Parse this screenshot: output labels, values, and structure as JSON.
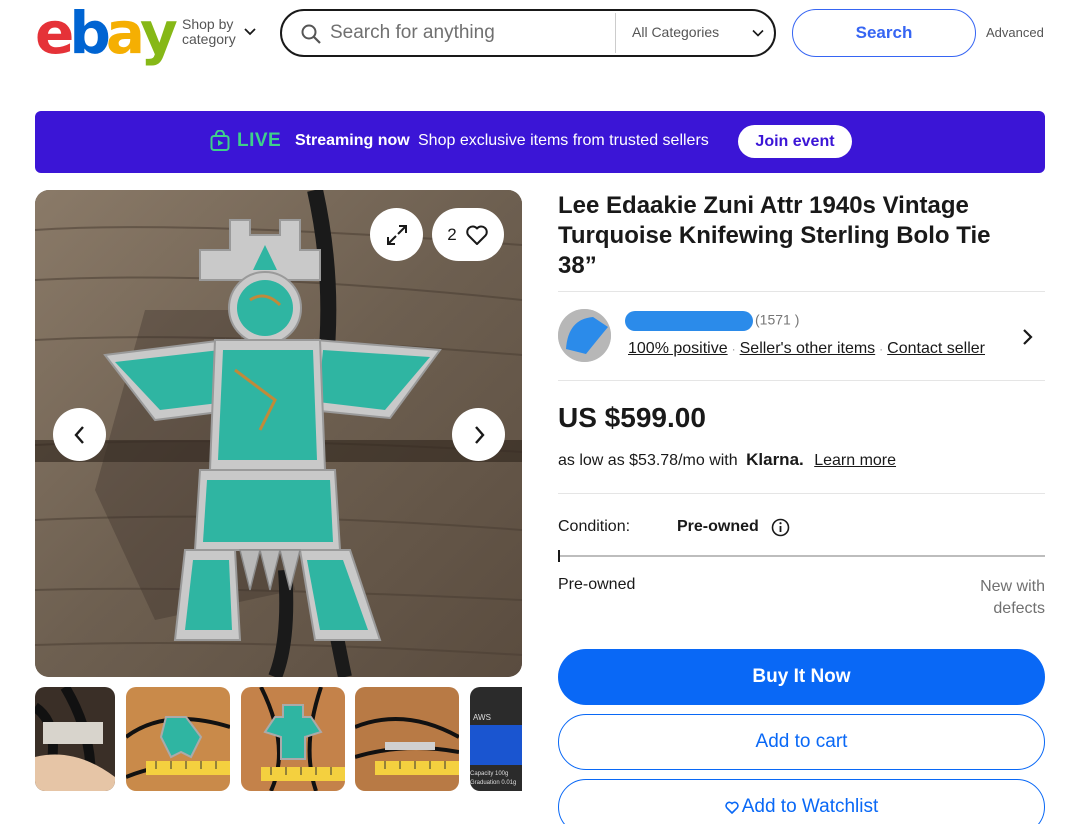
{
  "header": {
    "logo_letters": [
      "e",
      "b",
      "a",
      "y"
    ],
    "logo_colors": [
      "#e53238",
      "#0064d2",
      "#f5af02",
      "#86b817"
    ],
    "shop_by_line1": "Shop by",
    "shop_by_line2": "category",
    "search_placeholder": "Search for anything",
    "category_select": "All Categories",
    "search_button": "Search",
    "advanced_link": "Advanced"
  },
  "live_banner": {
    "live_label": "LIVE",
    "streaming_label": "Streaming now",
    "message": "Shop exclusive items from trusted sellers",
    "join_button": "Join event",
    "background": "#3b15d6",
    "live_color": "#3ed08a"
  },
  "gallery": {
    "watch_count": "2",
    "icons": [
      "expand-icon",
      "heart-icon",
      "chevron-left-icon",
      "chevron-right-icon"
    ],
    "thumb_scale_text": "AWS",
    "thumb_scale_caption1": "Capacity 100g",
    "thumb_scale_caption2": "Graduation 0.01g"
  },
  "listing": {
    "title": "Lee Edaakie Zuni Attr 1940s Vintage Turquoise Knifewing Sterling Bolo Tie 38”",
    "seller": {
      "feedback_count": "(1571 )",
      "positive": "100% positive",
      "other_items": "Seller's other items",
      "contact": "Contact seller"
    },
    "price": "US $599.00",
    "klarna": {
      "prefix": "as low as $53.78/mo with",
      "brand": "Klarna.",
      "learn_more": "Learn more"
    },
    "condition": {
      "label": "Condition:",
      "value": "Pre-owned",
      "scale_left": "Pre-owned",
      "scale_right": "New with defects"
    },
    "buttons": {
      "buy_now": "Buy It Now",
      "add_to_cart": "Add to cart",
      "add_to_watchlist": "Add to Watchlist"
    },
    "accent_color": "#0968f6"
  }
}
